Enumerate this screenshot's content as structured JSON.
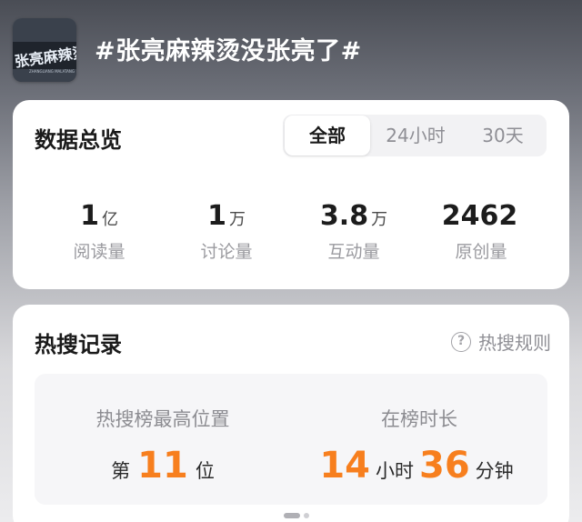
{
  "topic": {
    "title": "#张亮麻辣烫没张亮了#",
    "thumbnail_text": "张亮麻辣烫",
    "thumbnail_subtext": "ZHANGLIANG MALATANG"
  },
  "overview": {
    "title": "数据总览",
    "tabs": [
      {
        "label": "全部",
        "active": true
      },
      {
        "label": "24小时",
        "active": false
      },
      {
        "label": "30天",
        "active": false
      }
    ],
    "stats": [
      {
        "value": "1",
        "unit": "亿",
        "label": "阅读量"
      },
      {
        "value": "1",
        "unit": "万",
        "label": "讨论量"
      },
      {
        "value": "3.8",
        "unit": "万",
        "label": "互动量"
      },
      {
        "value": "2462",
        "unit": "",
        "label": "原创量"
      }
    ]
  },
  "hot_search": {
    "title": "热搜记录",
    "rules_link": "热搜规则",
    "rules_icon": "question-circle-icon",
    "highest_position": {
      "label": "热搜榜最高位置",
      "prefix": "第",
      "value": "11",
      "suffix": "位"
    },
    "duration": {
      "label": "在榜时长",
      "hours": "14",
      "hours_unit": "小时",
      "minutes": "36",
      "minutes_unit": "分钟"
    },
    "page_indicator": {
      "pages": 2,
      "active": 0
    }
  },
  "colors": {
    "accent_orange": "#f77f1e",
    "card_bg": "#ffffff",
    "muted_text": "#9a9a9f"
  }
}
